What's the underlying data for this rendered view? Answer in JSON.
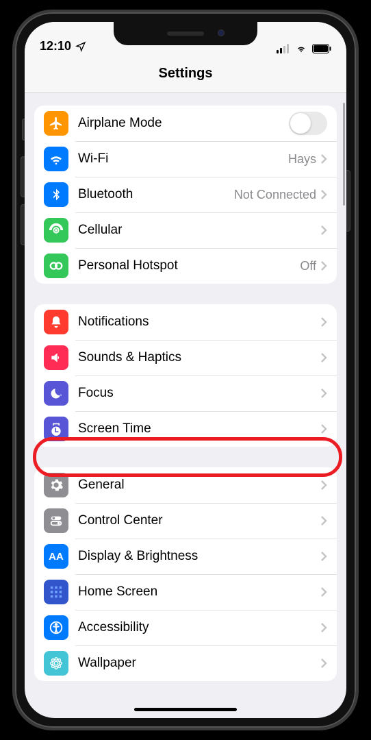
{
  "statusBar": {
    "time": "12:10",
    "locationIcon": "location-arrow",
    "cellularBars": 2,
    "wifiOn": true,
    "batteryFull": true
  },
  "header": {
    "title": "Settings"
  },
  "sections": [
    {
      "id": "connectivity",
      "rows": [
        {
          "id": "airplane",
          "label": "Airplane Mode",
          "iconColor": "#ff9500",
          "type": "toggle",
          "toggleOn": false
        },
        {
          "id": "wifi",
          "label": "Wi-Fi",
          "iconColor": "#007aff",
          "type": "disclosure",
          "value": "Hays"
        },
        {
          "id": "bluetooth",
          "label": "Bluetooth",
          "iconColor": "#007aff",
          "type": "disclosure",
          "value": "Not Connected"
        },
        {
          "id": "cellular",
          "label": "Cellular",
          "iconColor": "#34c759",
          "type": "disclosure",
          "value": ""
        },
        {
          "id": "hotspot",
          "label": "Personal Hotspot",
          "iconColor": "#34c759",
          "type": "disclosure",
          "value": "Off"
        }
      ]
    },
    {
      "id": "notifications-group",
      "rows": [
        {
          "id": "notifications",
          "label": "Notifications",
          "iconColor": "#ff3b30",
          "type": "disclosure",
          "value": ""
        },
        {
          "id": "sounds",
          "label": "Sounds & Haptics",
          "iconColor": "#ff2d55",
          "type": "disclosure",
          "value": ""
        },
        {
          "id": "focus",
          "label": "Focus",
          "iconColor": "#5856d6",
          "type": "disclosure",
          "value": ""
        },
        {
          "id": "screentime",
          "label": "Screen Time",
          "iconColor": "#5856d6",
          "type": "disclosure",
          "value": ""
        }
      ]
    },
    {
      "id": "general-group",
      "rows": [
        {
          "id": "general",
          "label": "General",
          "iconColor": "#8e8e93",
          "type": "disclosure",
          "value": "",
          "highlighted": true
        },
        {
          "id": "controlcenter",
          "label": "Control Center",
          "iconColor": "#8e8e93",
          "type": "disclosure",
          "value": ""
        },
        {
          "id": "display",
          "label": "Display & Brightness",
          "iconColor": "#007aff",
          "type": "disclosure",
          "value": ""
        },
        {
          "id": "homescreen",
          "label": "Home Screen",
          "iconColor": "#3355cc",
          "type": "disclosure",
          "value": ""
        },
        {
          "id": "accessibility",
          "label": "Accessibility",
          "iconColor": "#007aff",
          "type": "disclosure",
          "value": ""
        },
        {
          "id": "wallpaper",
          "label": "Wallpaper",
          "iconColor": "#43c5d6",
          "type": "disclosure",
          "value": ""
        }
      ]
    }
  ]
}
